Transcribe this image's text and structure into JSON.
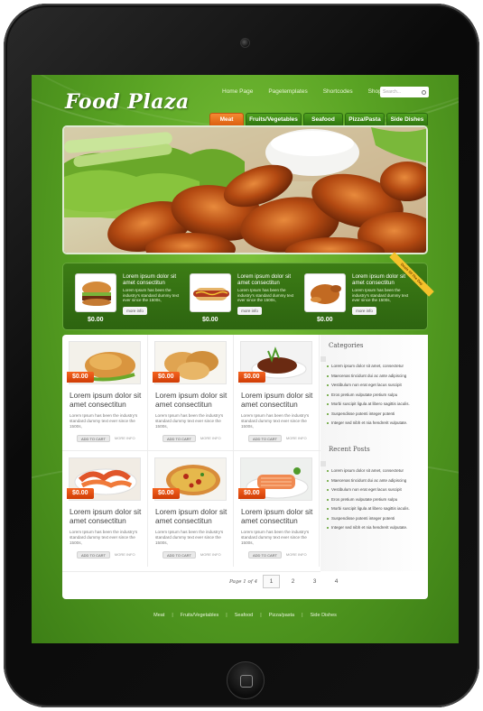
{
  "brand": {
    "logo": "Food Plaza"
  },
  "top_nav": [
    "Home Page",
    "Pagetemplates",
    "Shortcodes",
    "Shoppingcart"
  ],
  "search": {
    "placeholder": "Search..."
  },
  "tabs": [
    {
      "label": "Meat",
      "active": true
    },
    {
      "label": "Fruits/Vegetables",
      "active": false
    },
    {
      "label": "Seafood",
      "active": false
    },
    {
      "label": "Pizza/Pasta",
      "active": false
    },
    {
      "label": "Side Dishes",
      "active": false
    }
  ],
  "featured": {
    "ribbon": "Deals Of The Day",
    "items": [
      {
        "icon": "burger-image",
        "title": "Lorem ipsum dolor sit amet consectitun",
        "desc": "Lorem Ipsum has been the industry's standard dummy text ever since the 1500s,",
        "more": "more info",
        "price": "$0.00"
      },
      {
        "icon": "hotdog-image",
        "title": "Lorem ipsum dolor sit amet consectitun",
        "desc": "Lorem Ipsum has been the industry's standard dummy text ever since the 1500s,",
        "more": "more info",
        "price": "$0.00"
      },
      {
        "icon": "roast-chicken-image",
        "title": "Lorem ipsum dolor sit amet consectitun",
        "desc": "Lorem Ipsum has been the industry's standard dummy text ever since the 1500s,",
        "more": "more info",
        "price": "$0.00"
      }
    ]
  },
  "products": [
    {
      "icon": "roast-chicken-image",
      "price": "$0.00",
      "title": "Lorem ipsum dolor sit amet consectitun",
      "desc": "Lorem Ipsum has been the industry's standard dummy text ever since the 1500s,",
      "cart": "ADD TO CART",
      "more": "MORE INFO"
    },
    {
      "icon": "fried-chicken-image",
      "price": "$0.00",
      "title": "Lorem ipsum dolor sit amet consectitun",
      "desc": "Lorem Ipsum has been the industry's standard dummy text ever since the 1500s,",
      "cart": "ADD TO CART",
      "more": "MORE INFO"
    },
    {
      "icon": "steak-image",
      "price": "$0.00",
      "title": "Lorem ipsum dolor sit amet consectitun",
      "desc": "Lorem Ipsum has been the industry's standard dummy text ever since the 1500s,",
      "cart": "ADD TO CART",
      "more": "MORE INFO"
    },
    {
      "icon": "shrimp-image",
      "price": "$0.00",
      "title": "Lorem ipsum dolor sit amet consectitun",
      "desc": "Lorem Ipsum has been the industry's standard dummy text ever since the 1500s,",
      "cart": "ADD TO CART",
      "more": "MORE INFO"
    },
    {
      "icon": "pizza-image",
      "price": "$0.00",
      "title": "Lorem ipsum dolor sit amet consectitun",
      "desc": "Lorem Ipsum has been the industry's standard dummy text ever since the 1500s,",
      "cart": "ADD TO CART",
      "more": "MORE INFO"
    },
    {
      "icon": "salmon-image",
      "price": "$0.00",
      "title": "Lorem ipsum dolor sit amet consectitun",
      "desc": "Lorem Ipsum has been the industry's standard dummy text ever since the 1500s,",
      "cart": "ADD TO CART",
      "more": "MORE INFO"
    }
  ],
  "sidebar": {
    "categories_title": "Categories",
    "categories": [
      "Lorem ipsum dolor sit amet, consectetur",
      "Maecenas tincidunt dui ac ante adipiscing",
      "Vestibulum non erat eget lacus suscipit",
      "Eros pretium vulputate pretium sulpu",
      "Morbi suscipit ligula at libero sagittis iaculis.",
      "Suspendisse potenti integer potenti",
      "Integer sed nibh et nia hendrerit vulputate."
    ],
    "recent_title": "Recent Posts",
    "recent": [
      "Lorem ipsum dolor sit amet, consectetur",
      "Maecenas tincidunt dui ac ante adipiscing",
      "Vestibulum non erat eget lacus suscipit",
      "Eros pretium vulputate pretium sulpu",
      "Morbi suscipit ligula at libero sagittis iaculis.",
      "Suspendisse potenti integer potenti",
      "Integer sed nibh et nia hendrerit vulputate."
    ]
  },
  "pagination": {
    "label": "Page 1 of 4",
    "pages": [
      "1",
      "2",
      "3",
      "4"
    ],
    "current": "1"
  },
  "footer": [
    "Meat",
    "Fruits/Vegetables",
    "Seafood",
    "Pizza/pasta",
    "Side Dishes"
  ],
  "colors": {
    "accent": "#f26a1b",
    "brand_green": "#5aa424",
    "dark_green": "#2d6410"
  }
}
